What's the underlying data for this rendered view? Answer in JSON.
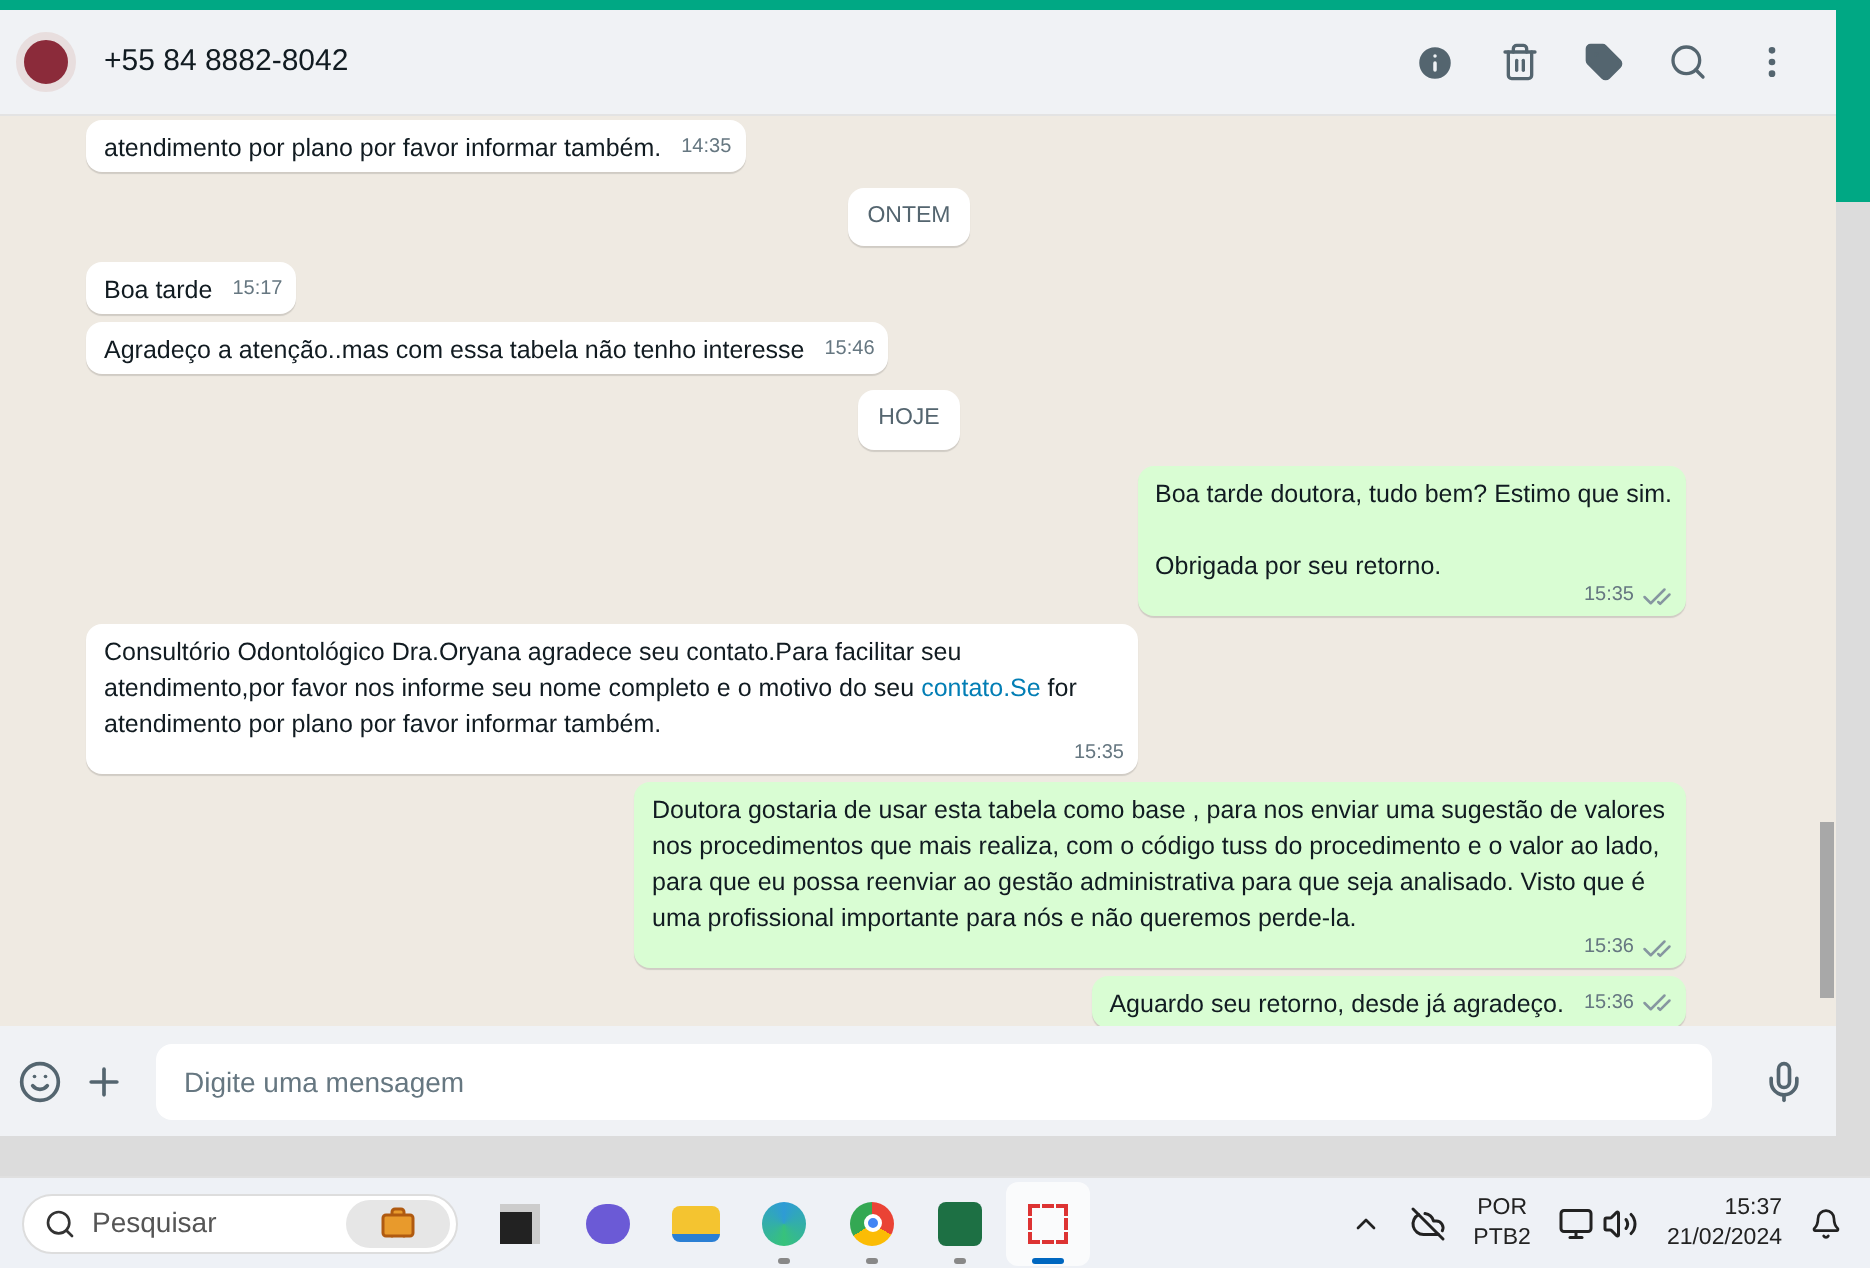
{
  "header": {
    "title": "+55 84 8882-8042"
  },
  "messages": [
    {
      "kind": "in",
      "parts": [
        {
          "text": "atendimento por plano por favor informar também."
        }
      ],
      "time": "14:35"
    },
    {
      "kind": "date",
      "label": "ONTEM"
    },
    {
      "kind": "in",
      "parts": [
        {
          "text": "Boa tarde"
        }
      ],
      "time": "15:17"
    },
    {
      "kind": "in",
      "parts": [
        {
          "text": "Agradeço a atenção..mas com essa tabela não tenho interesse"
        }
      ],
      "time": "15:46"
    },
    {
      "kind": "date",
      "label": "HOJE"
    },
    {
      "kind": "out",
      "parts": [
        {
          "text": "Boa tarde doutora, tudo bem? Estimo que sim.\n\nObrigada por seu retorno."
        }
      ],
      "time": "15:35"
    },
    {
      "kind": "in",
      "parts": [
        {
          "text": "Consultório Odontológico Dra.Oryana agradece seu contato.Para facilitar seu atendimento,por favor nos informe seu nome completo e o motivo do seu "
        },
        {
          "text": "contato.Se",
          "link": true
        },
        {
          "text": " for atendimento por plano por favor informar também."
        }
      ],
      "time": "15:35"
    },
    {
      "kind": "out",
      "parts": [
        {
          "text": "Doutora gostaria de usar esta tabela como base , para nos enviar uma sugestão de valores nos procedimentos que mais realiza, com o código tuss do procedimento e o valor ao lado, para que eu possa reenviar ao gestão administrativa para que seja analisado. Visto que é uma profissional importante para nós e não queremos perde-la."
        }
      ],
      "time": "15:36"
    },
    {
      "kind": "out",
      "parts": [
        {
          "text": "Aguardo seu retorno, desde já agradeço."
        }
      ],
      "time": "15:36"
    }
  ],
  "composer": {
    "placeholder": "Digite uma mensagem"
  },
  "taskbar": {
    "search_placeholder": "Pesquisar",
    "language": "POR",
    "layout": "PTB2",
    "time": "15:37",
    "date": "21/02/2024"
  }
}
